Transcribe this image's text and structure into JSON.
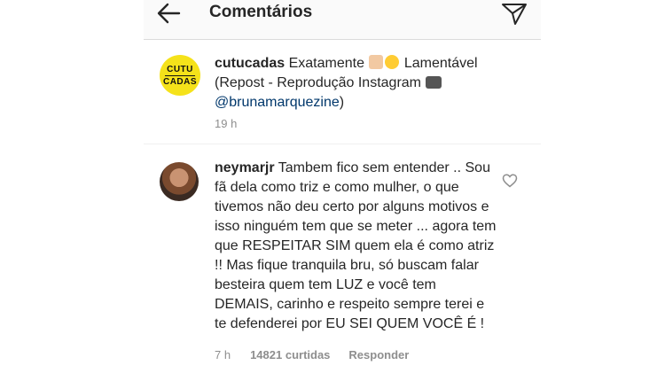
{
  "header": {
    "title": "Comentários"
  },
  "caption": {
    "username": "cutucadas",
    "logo_line1": "CUTU",
    "logo_line2": "CADAS",
    "text_part1": " Exatamente ",
    "text_part2": " Lamentável (Repost - Reprodução Instagram ",
    "mention": "@brunamarquezine",
    "text_end": ")",
    "time": "19 h"
  },
  "comment": {
    "username": "neymarjr",
    "text": " Tambem fico sem entender .. Sou fã dela como triz e como mulher, o que tivemos não deu certo por alguns motivos e isso ninguém tem que se meter ... agora tem que RESPEITAR SIM quem ela é como atriz !! Mas fique tranquila bru, só buscam falar besteira quem tem LUZ e você tem DEMAIS, carinho e respeito sempre terei e te defenderei por EU SEI QUEM VOCÊ É !",
    "time": "7 h",
    "likes": "14821 curtidas",
    "reply": "Responder"
  },
  "icons": {
    "back": "arrow-left-icon",
    "send": "send-icon",
    "like": "heart-icon"
  }
}
